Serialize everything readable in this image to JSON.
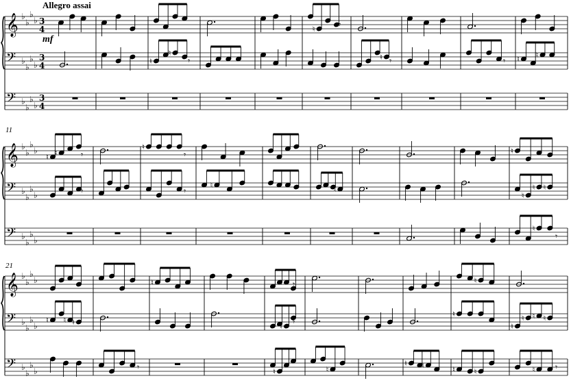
{
  "score": {
    "tempo_marking": "Allegro assai",
    "dynamic": "mf",
    "time_signature": "3/4",
    "key_signature": "A-flat major (4 flats)",
    "systems": [
      {
        "start_measure": "",
        "measures": 10
      },
      {
        "start_measure": "11",
        "measures": 10
      },
      {
        "start_measure": "21",
        "measures": 12
      }
    ],
    "staves": [
      "right hand (treble)",
      "left hand (bass)",
      "pedal (bass)"
    ]
  }
}
